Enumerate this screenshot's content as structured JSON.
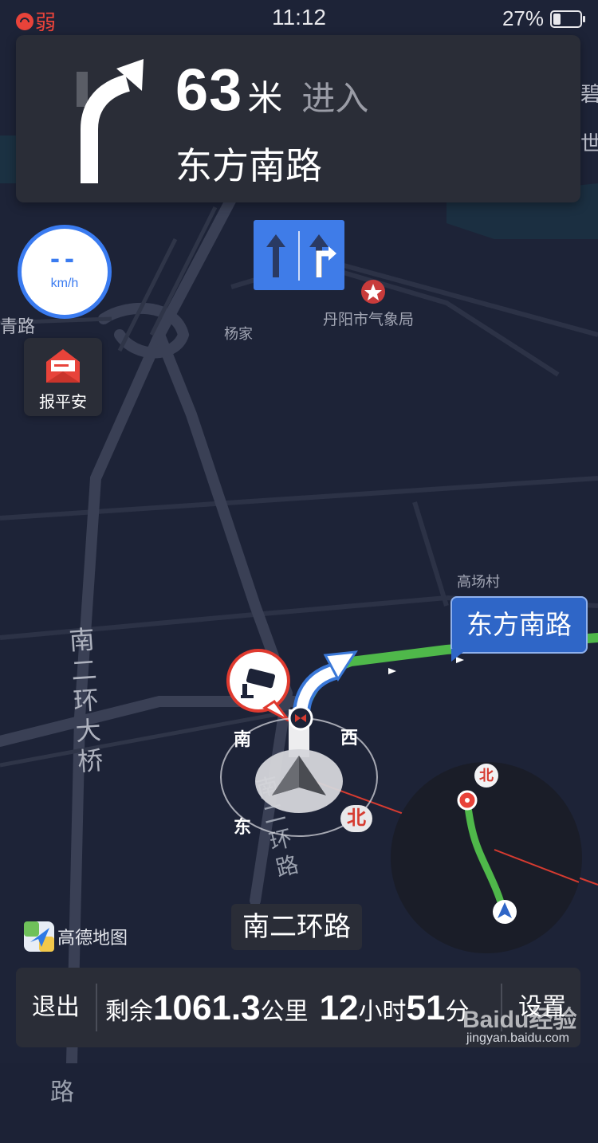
{
  "status_bar": {
    "signal_label": "弱",
    "time": "11:12",
    "battery_percent": "27%",
    "battery_level": 0.27
  },
  "guidance": {
    "distance_value": "63",
    "distance_unit": "米",
    "action": "进入",
    "next_road": "东方南路",
    "turn_icon": "turn-right-arrow"
  },
  "lanes": [
    "straight",
    "straight-or-right"
  ],
  "speed": {
    "value": "--",
    "unit": "km/h"
  },
  "report_safe": {
    "label": "报平安"
  },
  "map": {
    "labels": {
      "road_left": "青路",
      "poi_yangjia": "杨家",
      "poi_weather": "丹阳市气象局",
      "poi_village": "高场村",
      "bridge_name": [
        "南",
        "二",
        "环",
        "大",
        "桥"
      ],
      "road_south_second_ring": [
        "南",
        "二",
        "环",
        "路"
      ],
      "road_bottom_left": [
        "南",
        "路"
      ],
      "edge_top_right": [
        "碧",
        "世"
      ]
    },
    "road_callout": "东方南路",
    "camera_icon": "speed-camera-icon",
    "compass": {
      "south": "南",
      "west": "西",
      "east": "东",
      "north": "北"
    }
  },
  "overview": {
    "north": "北"
  },
  "current_road": "南二环路",
  "logo": {
    "text": "高德地图"
  },
  "bottom_bar": {
    "exit_label": "退出",
    "remaining_label": "剩余",
    "distance_value": "1061.3",
    "distance_unit": "公里",
    "hours_value": "12",
    "hours_unit": "小时",
    "minutes_value": "51",
    "minutes_unit": "分",
    "settings_label": "设置"
  },
  "watermark": {
    "brand": "Baidu经验",
    "url": "jingyan.baidu.com"
  },
  "colors": {
    "map_bg": "#1c2236",
    "road": "#353b4d",
    "route_green": "#4fb84a",
    "accent_blue": "#3f7ce8",
    "camera_red": "#e03a2f"
  }
}
